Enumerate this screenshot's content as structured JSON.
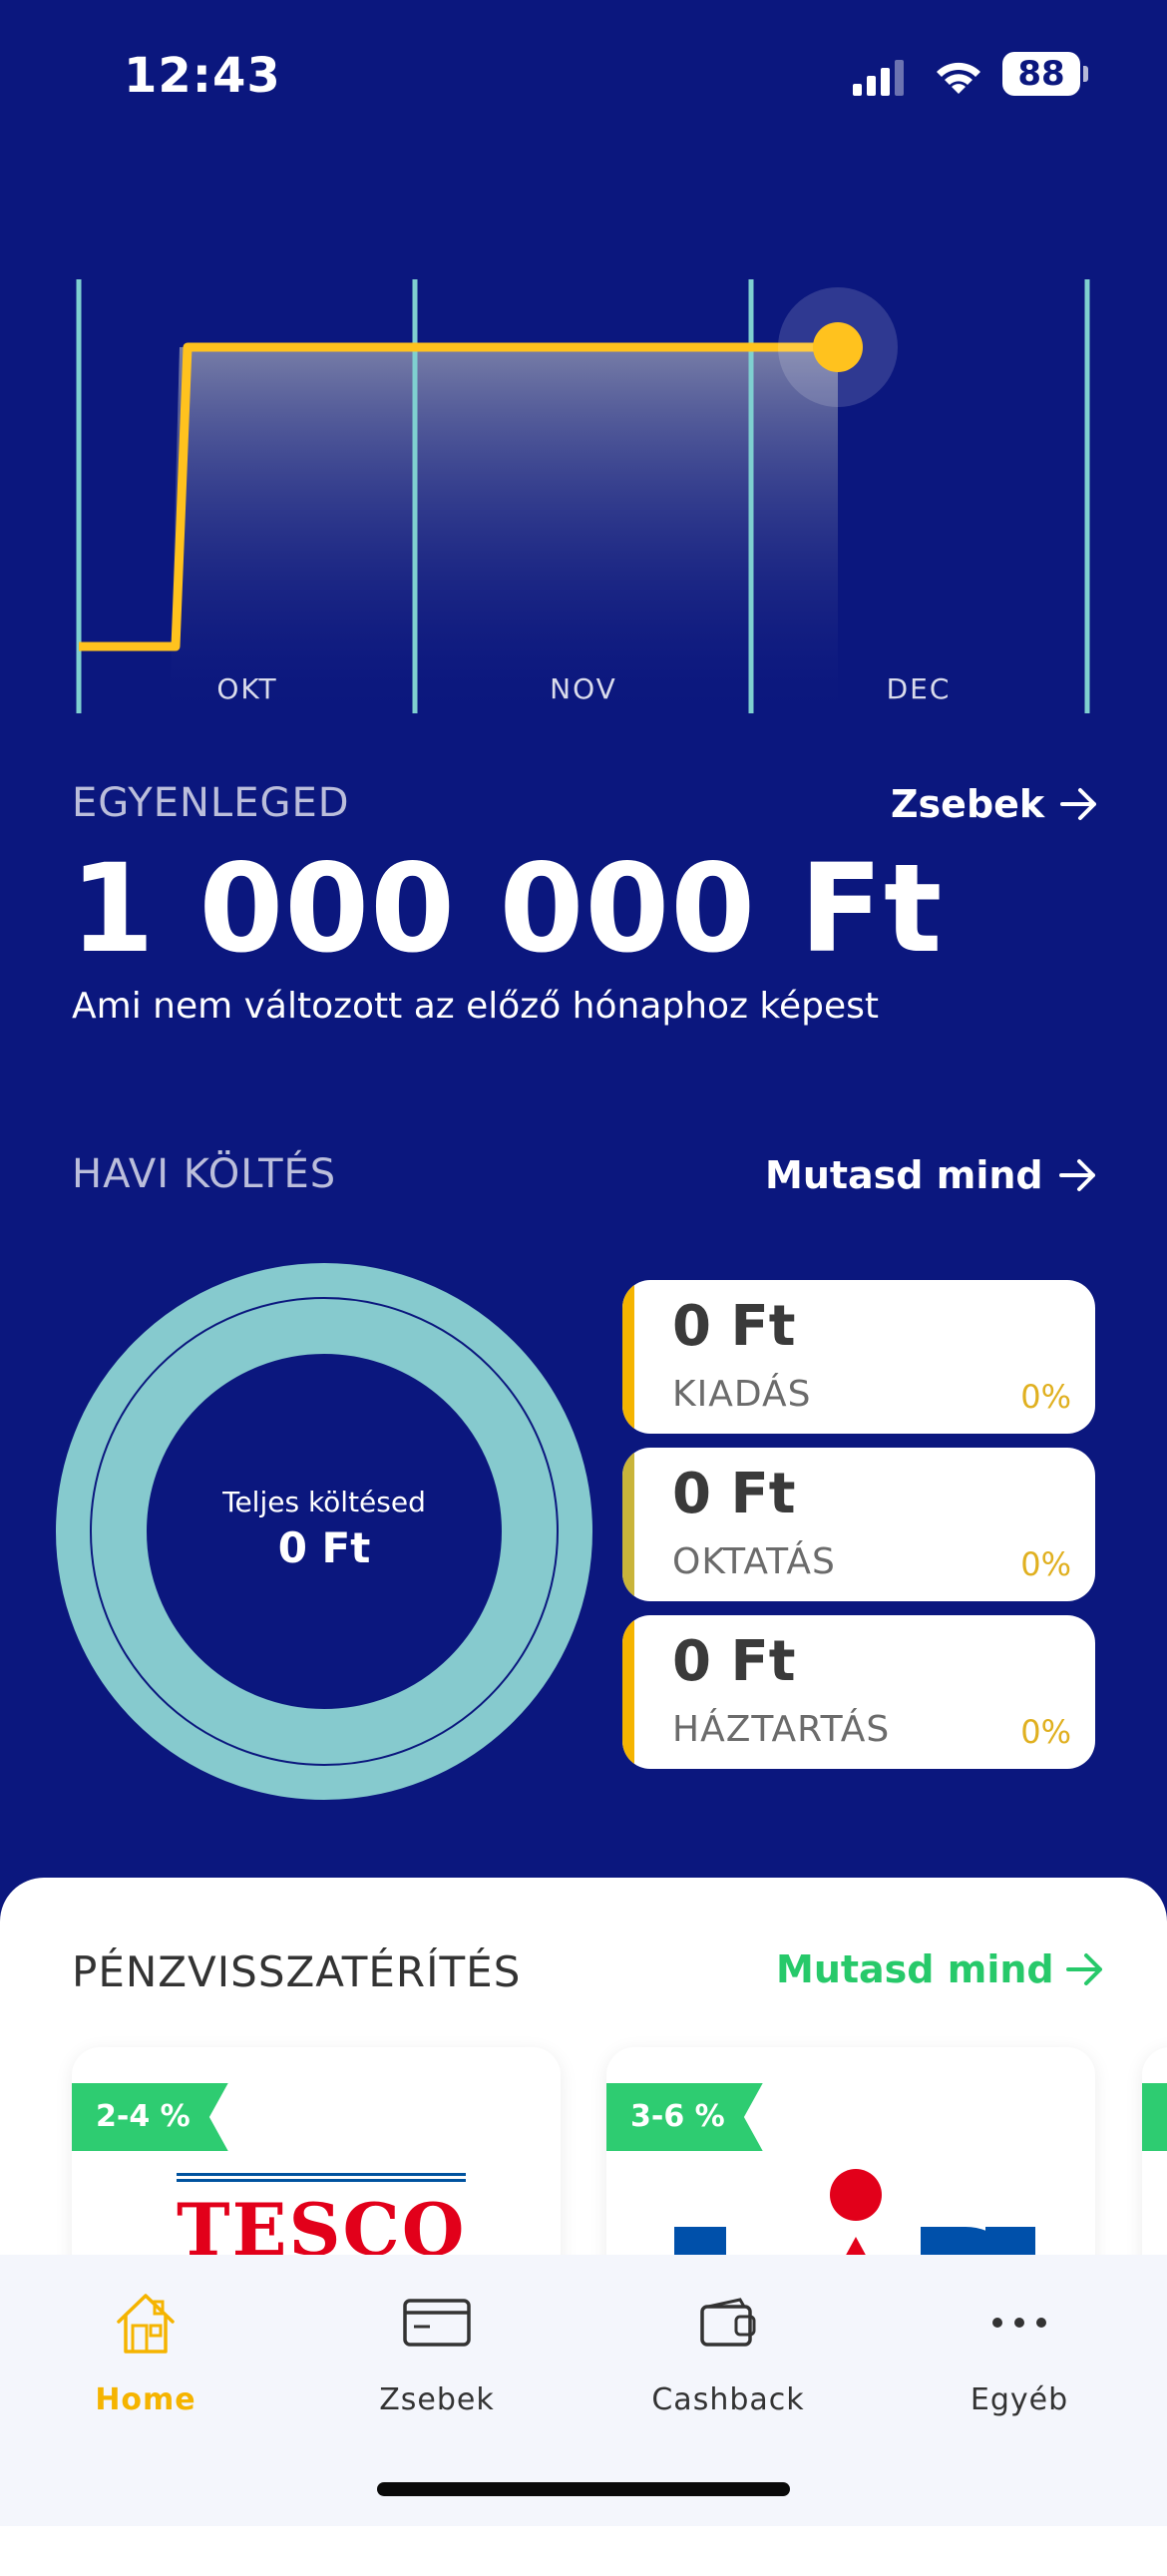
{
  "status_bar": {
    "time": "12:43",
    "battery": "88"
  },
  "chart": {
    "months": [
      "OKT",
      "NOV",
      "DEC"
    ],
    "line_color": "#FFC21E",
    "grid_color": "#7FD0D0"
  },
  "balance": {
    "label": "EGYENLEGED",
    "link": "Zsebek",
    "amount": "1 000 000 Ft",
    "subtitle": "Ami nem változott az előző hónaphoz képest"
  },
  "monthly": {
    "label": "HAVI KÖLTÉS",
    "link": "Mutasd mind",
    "ring_title": "Teljes költésed",
    "ring_value": "0 Ft",
    "ring_color": "#86CACE",
    "cards": [
      {
        "amount": "0 Ft",
        "category": "KIADÁS",
        "percent": "0%"
      },
      {
        "amount": "0 Ft",
        "category": "OKTATÁS",
        "percent": "0%"
      },
      {
        "amount": "0 Ft",
        "category": "HÁZTARTÁS",
        "percent": "0%"
      }
    ]
  },
  "cashback": {
    "title": "PÉNZVISSZATÉRÍTÉS",
    "link": "Mutasd mind",
    "offers": [
      {
        "tag": "2-4 %",
        "brand": "TESCO"
      },
      {
        "tag": "3-6 %",
        "brand": "LIDL"
      }
    ]
  },
  "tabbar": {
    "items": [
      {
        "label": "Home",
        "icon": "home-icon",
        "active": true
      },
      {
        "label": "Zsebek",
        "icon": "card-icon"
      },
      {
        "label": "Cashback",
        "icon": "wallet-icon"
      },
      {
        "label": "Egyéb",
        "icon": "more-dots-icon"
      }
    ]
  },
  "colors": {
    "background": "#0B177E",
    "accent_yellow": "#F5B400",
    "accent_green": "#27C96A"
  }
}
